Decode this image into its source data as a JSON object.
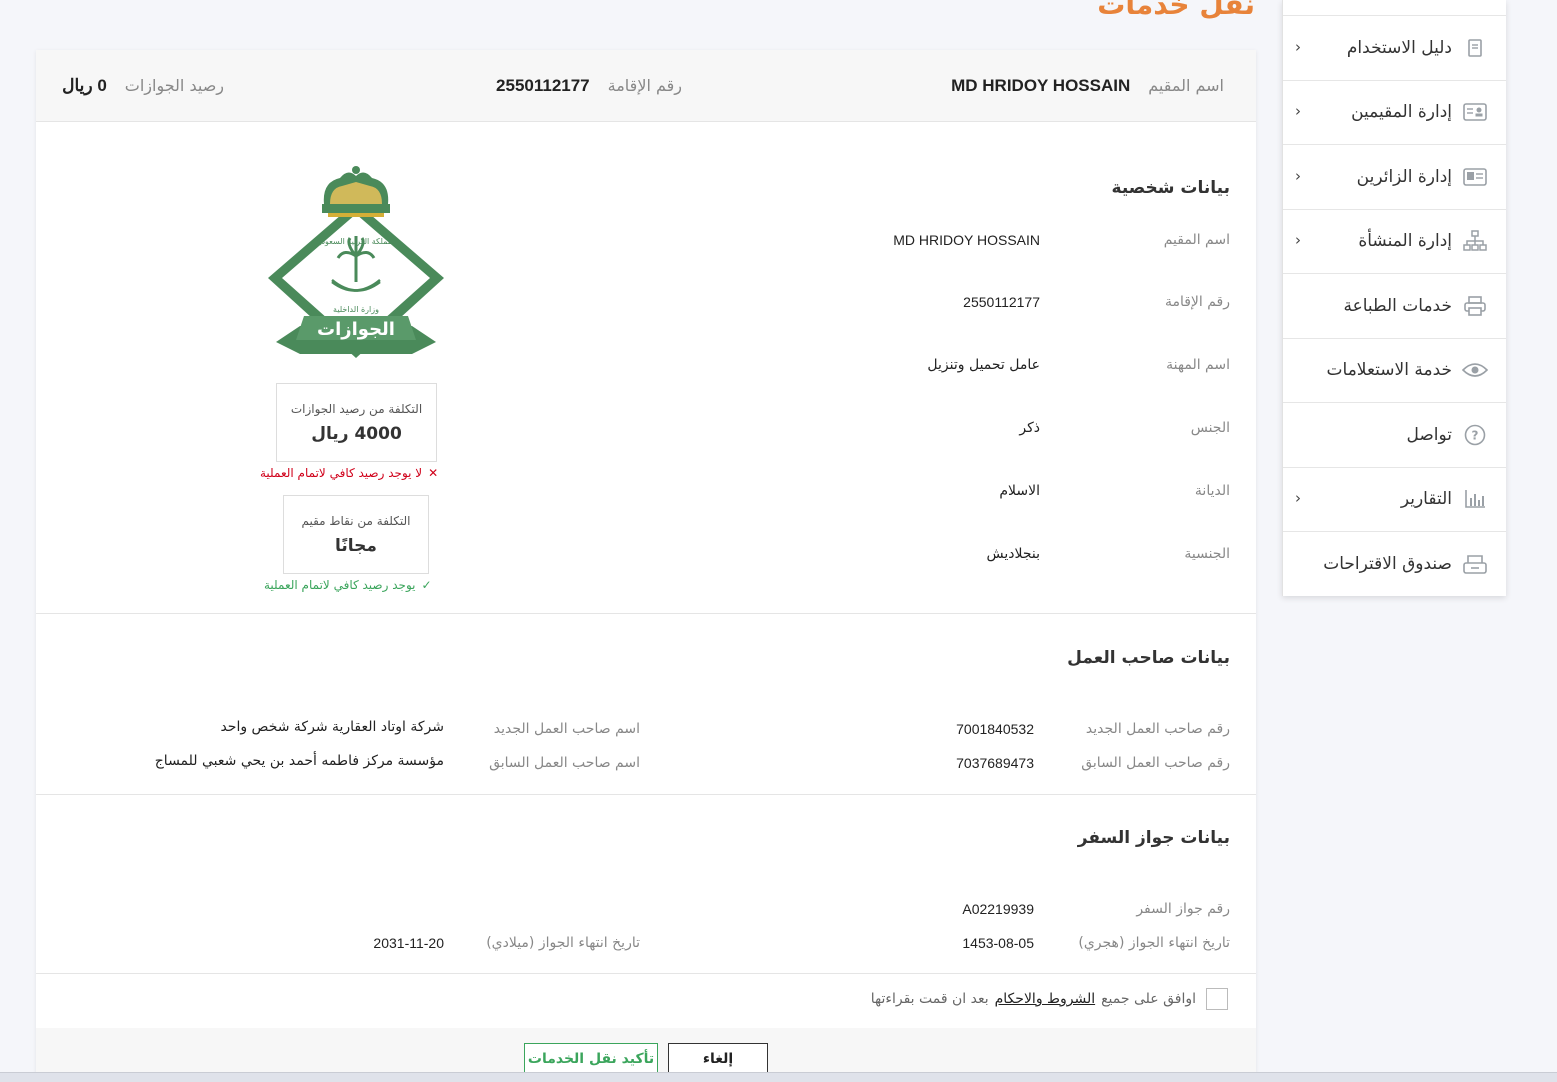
{
  "page_title": "نقل خدمات",
  "sidebar": {
    "items": [
      {
        "label": "دليل الاستخدام",
        "icon": "book-icon",
        "has_arrow": true
      },
      {
        "label": "إدارة المقيمين",
        "icon": "id-card-icon",
        "has_arrow": true
      },
      {
        "label": "إدارة الزائرين",
        "icon": "visitor-card-icon",
        "has_arrow": true
      },
      {
        "label": "إدارة المنشأة",
        "icon": "org-chart-icon",
        "has_arrow": true
      },
      {
        "label": "خدمات الطباعة",
        "icon": "printer-icon",
        "has_arrow": false
      },
      {
        "label": "خدمة الاستعلامات",
        "icon": "eye-icon",
        "has_arrow": false
      },
      {
        "label": "تواصل",
        "icon": "help-circle-icon",
        "has_arrow": false
      },
      {
        "label": "التقارير",
        "icon": "bar-chart-icon",
        "has_arrow": true
      },
      {
        "label": "صندوق الاقتراحات",
        "icon": "inbox-icon",
        "has_arrow": false
      }
    ],
    "chevron": "‹"
  },
  "header": {
    "resident_name_label": "اسم المقيم",
    "resident_name": "MD HRIDOY HOSSAIN",
    "iqama_label": "رقم الإقامة",
    "iqama": "2550112177",
    "balance_label": "رصيد الجوازات",
    "balance": "0 ريال"
  },
  "personal": {
    "title": "بيانات شخصية",
    "fields": [
      {
        "label": "اسم المقيم",
        "value": "MD HRIDOY HOSSAIN"
      },
      {
        "label": "رقم الإقامة",
        "value": "2550112177"
      },
      {
        "label": "اسم المهنة",
        "value": "عامل تحميل وتنزيل"
      },
      {
        "label": "الجنس",
        "value": "ذكر"
      },
      {
        "label": "الديانة",
        "value": "الاسلام"
      },
      {
        "label": "الجنسية",
        "value": "بنجلاديش"
      }
    ]
  },
  "logo": {
    "top_text": "المملكة العربية السعودية",
    "bottom_text": "وزارة الداخلية",
    "banner_text": "الجوازات"
  },
  "cost": {
    "passports_label": "التكلفة من رصيد الجوازات",
    "passports_value": "4000 ريال",
    "passports_status": "لا يوجد رصيد كافي لاتمام العملية",
    "points_label": "التكلفة من نقاط مقيم",
    "points_value": "مجانًا",
    "points_status": "يوجد رصيد كافي لاتمام العملية",
    "err_mark": "✕",
    "ok_mark": "✓"
  },
  "employer": {
    "title": "بيانات صاحب العمل",
    "new_number_label": "رقم صاحب العمل الجديد",
    "new_number": "7001840532",
    "new_name_label": "اسم صاحب العمل الجديد",
    "new_name": "شركة اوتاد العقارية شركة شخص واحد",
    "old_number_label": "رقم صاحب العمل السابق",
    "old_number": "7037689473",
    "old_name_label": "اسم صاحب العمل السابق",
    "old_name": "مؤسسة مركز فاطمه أحمد بن يحي شعبي للمساج"
  },
  "passport": {
    "title": "بيانات جواز السفر",
    "number_label": "رقم جواز السفر",
    "number": "A02219939",
    "expiry_hijri_label": "تاريخ انتهاء الجواز (هجري)",
    "expiry_hijri": "1453-08-05",
    "expiry_greg_label": "تاريخ انتهاء الجواز (ميلادي)",
    "expiry_greg": "2031-11-20"
  },
  "agreement": {
    "prefix": "اوافق على جميع",
    "link": "الشروط والاحكام",
    "suffix": "بعد ان قمت بقراءتها"
  },
  "buttons": {
    "cancel": "إلغاء",
    "confirm": "تأكيد نقل الخدمات"
  },
  "colors": {
    "accent": "#e8833a",
    "success": "#3ba55c",
    "error": "#d0021b",
    "logo_green": "#4a8a5a"
  }
}
